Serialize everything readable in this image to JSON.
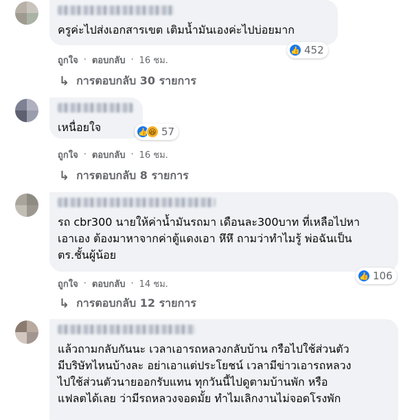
{
  "icons": {
    "like": "like-icon",
    "haha": "haha-icon",
    "reply": "reply-arrow-icon"
  },
  "colors": {
    "bubble": "#f0f2f5",
    "like_blue": "#1877f2",
    "muted": "#65676b"
  },
  "comments": [
    {
      "text": "ครูค่ะไปส่งเอกสารเขต เติมน้ำมันเองค่ะไปบ่อยมาก",
      "reactions": {
        "count": "452",
        "types": [
          "like"
        ]
      },
      "like_label": "ถูกใจ",
      "reply_label": "ตอบกลับ",
      "time": "16 ชม.",
      "replies_label": "การตอบกลับ 30 รายการ"
    },
    {
      "text": "เหนื่อยใจ",
      "reactions": {
        "count": "57",
        "types": [
          "like",
          "haha"
        ]
      },
      "like_label": "ถูกใจ",
      "reply_label": "ตอบกลับ",
      "time": "16 ชม.",
      "replies_label": "การตอบกลับ 8 รายการ"
    },
    {
      "text": "รถ cbr300 นายให้ค่าน้ำมันรถมา เดือนละ300บาท ที่เหลือไปหา\nเอาเอง ต้องมาหาจากค่าตู้แดงเอา หึหึ ถามว่าทำไมรู้ พ่อฉันเป็น\nตร.ชั้นผู้น้อย",
      "reactions": {
        "count": "106",
        "types": [
          "like"
        ]
      },
      "like_label": "ถูกใจ",
      "reply_label": "ตอบกลับ",
      "time": "14 ชม.",
      "replies_label": "การตอบกลับ 12 รายการ"
    },
    {
      "text": "แล้วถามกลับกันนะ เวลาเอารถหลวงกลับบ้าน กรือไปใช้ส่วนตัว\nมีบริษัทไหนบ้างละ อย่าเอาแต่ประโยชน์ เวลามีข่าวเอารถหลวง\nไปใช้ส่วนตัวนายออกรับแทน ทุกวันนี้ไปดูตามบ้านพัก หรือ\nแฟลตได้เลย ว่ามีรถหลวงจอดมั้ย ทำไมเลิกงานไม่จอดโรงพัก"
    }
  ]
}
